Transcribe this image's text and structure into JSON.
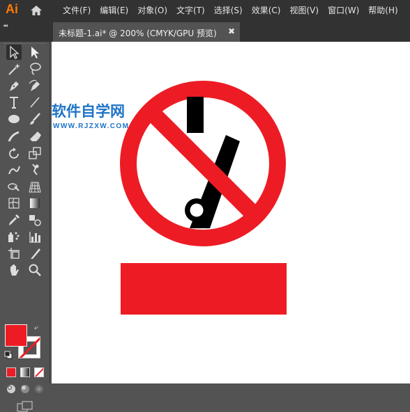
{
  "app": {
    "logo": "Ai"
  },
  "menus": [
    "文件(F)",
    "编辑(E)",
    "对象(O)",
    "文字(T)",
    "选择(S)",
    "效果(C)",
    "视图(V)",
    "窗口(W)",
    "帮助(H)"
  ],
  "document_tab": {
    "title": "未标题-1.ai* @ 200% (CMYK/GPU 预览)",
    "close_glyph": "✖"
  },
  "panel": {
    "collapse_glyph": "◂◂"
  },
  "tools": [
    "selection-tool",
    "direct-selection-tool",
    "magic-wand-tool",
    "lasso-tool",
    "pen-tool",
    "curvature-tool",
    "type-tool",
    "line-segment-tool",
    "ellipse-tool",
    "paintbrush-tool",
    "shaper-tool",
    "eraser-tool",
    "rotate-tool",
    "scale-tool",
    "warp-tool",
    "puppet-warp-tool",
    "shape-builder-tool",
    "perspective-grid-tool",
    "mesh-tool",
    "gradient-tool",
    "eyedropper-tool",
    "blend-tool",
    "symbol-sprayer-tool",
    "column-graph-tool",
    "artboard-tool",
    "slice-tool",
    "hand-tool",
    "zoom-tool"
  ],
  "colors": {
    "fill": "#ed1c24",
    "stroke": "#ffffff",
    "art_red": "#ed1c24",
    "art_black": "#000000"
  },
  "swap_glyph": "⤶",
  "watermark": {
    "name": "软件自学网",
    "url": "WWW.RJZXW.COM"
  }
}
